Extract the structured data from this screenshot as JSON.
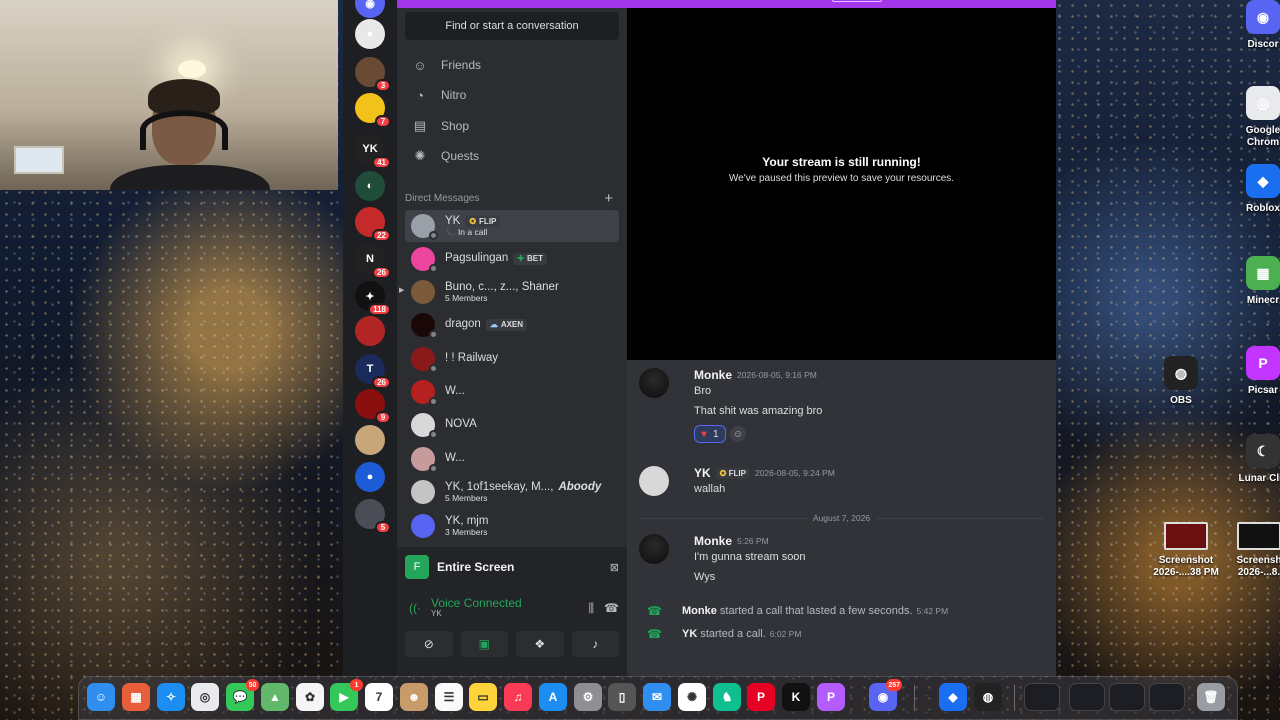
{
  "desktop": {
    "icons": [
      {
        "label": "Discor",
        "name": "desktop-icon-discord",
        "color": "#5865f2",
        "glyph": "◉"
      },
      {
        "label": "Google\nChrom",
        "name": "desktop-icon-chrome",
        "color": "#e8eaed",
        "glyph": "◎"
      },
      {
        "label": "Roblox",
        "name": "desktop-icon-roblox",
        "color": "#1a6ff0",
        "glyph": "◆"
      },
      {
        "label": "Minecr",
        "name": "desktop-icon-minecraft",
        "color": "#4caf50",
        "glyph": "▦"
      },
      {
        "label": "OBS",
        "name": "desktop-icon-obs",
        "color": "#222",
        "glyph": "◍"
      },
      {
        "label": "Picsar",
        "name": "desktop-icon-picsart",
        "color": "#c135ff",
        "glyph": "P"
      },
      {
        "label": "Lunar Clie",
        "name": "desktop-icon-lunar-client",
        "color": "#333",
        "glyph": "☾"
      },
      {
        "label": "Screenshot\n2026-....38 PM",
        "name": "desktop-icon-screenshot-1",
        "color": "#6a1010",
        "glyph": ""
      },
      {
        "label": "Screensh\n2026-...8.",
        "name": "desktop-icon-screenshot-2",
        "color": "#111",
        "glyph": ""
      }
    ]
  },
  "discord": {
    "search_placeholder": "Find or start a conversation",
    "nav": [
      {
        "label": "Friends",
        "icon": "friends-icon",
        "glyph": "☺"
      },
      {
        "label": "Nitro",
        "icon": "nitro-icon",
        "glyph": "◔"
      },
      {
        "label": "Shop",
        "icon": "shop-icon",
        "glyph": "▤"
      },
      {
        "label": "Quests",
        "icon": "quests-icon",
        "glyph": "✺"
      }
    ],
    "dm_header": "Direct Messages",
    "servers": [
      {
        "badge": "",
        "color": "#5865f2",
        "glyph": "◉"
      },
      {
        "badge": "",
        "color": "#e8e8e8",
        "glyph": "●"
      },
      {
        "badge": "3",
        "color": "#6b4a35",
        "glyph": ""
      },
      {
        "badge": "7",
        "color": "#f2c21b",
        "glyph": ""
      },
      {
        "badge": "41",
        "color": "#222",
        "glyph": "YK"
      },
      {
        "badge": "",
        "color": "#1f4d3a",
        "glyph": "◐"
      },
      {
        "badge": "22",
        "color": "#c42a2a",
        "glyph": ""
      },
      {
        "badge": "26",
        "color": "#222",
        "glyph": "N"
      },
      {
        "badge": "118",
        "color": "#111",
        "glyph": "✦"
      },
      {
        "badge": "",
        "color": "#b12525",
        "glyph": ""
      },
      {
        "badge": "26",
        "color": "#1a2a5a",
        "glyph": "T"
      },
      {
        "badge": "9",
        "color": "#8a1010",
        "glyph": ""
      },
      {
        "badge": "",
        "color": "#c9a67a",
        "glyph": ""
      },
      {
        "badge": "",
        "color": "#1e5bd6",
        "glyph": "●"
      },
      {
        "badge": "5",
        "color": "#4a4d55",
        "glyph": ""
      }
    ],
    "dms": [
      {
        "name": "YK",
        "tag": "FLIP",
        "tag_icon": "✪",
        "sub": "📞 In a call",
        "color": "#9aa0a8",
        "active": true,
        "italic_tail": ""
      },
      {
        "name": "Pagsulingan",
        "tag": "BET",
        "tag_icon": "✚",
        "sub": "",
        "color": "#eb459e",
        "active": false,
        "italic_tail": ""
      },
      {
        "name": "Buno, c..., z..., Shaner",
        "tag": "",
        "tag_icon": "",
        "sub": "5 Members",
        "color": "#7a5a3a",
        "active": false,
        "italic_tail": ""
      },
      {
        "name": "dragon",
        "tag": "AXEN",
        "tag_icon": "☁",
        "sub": "",
        "color": "#1a0808",
        "active": false,
        "italic_tail": ""
      },
      {
        "name": "! ! Railway",
        "tag": "",
        "tag_icon": "",
        "sub": "",
        "color": "#8a1a1a",
        "active": false,
        "italic_tail": ""
      },
      {
        "name": "W...",
        "tag": "",
        "tag_icon": "",
        "sub": "",
        "color": "#b52020",
        "active": false,
        "italic_tail": ""
      },
      {
        "name": "NOVA",
        "tag": "",
        "tag_icon": "",
        "sub": "",
        "color": "#d8d8d8",
        "active": false,
        "italic_tail": ""
      },
      {
        "name": "W...",
        "tag": "",
        "tag_icon": "",
        "sub": "",
        "color": "#c79b9b",
        "active": false,
        "italic_tail": ""
      },
      {
        "name": "YK, 1of1seekay, M...,",
        "tag": "",
        "tag_icon": "",
        "sub": "5 Members",
        "color": "#c4c4c4",
        "active": false,
        "italic_tail": "Aboody"
      },
      {
        "name": "YK, mjm",
        "tag": "",
        "tag_icon": "",
        "sub": "3 Members",
        "color": "#5865f2",
        "active": false,
        "italic_tail": ""
      }
    ],
    "stream": {
      "label": "Entire Screen"
    },
    "voice": {
      "status": "Voice Connected",
      "channel": "YK"
    },
    "preview": {
      "title": "Your stream is still running!",
      "subtitle": "We've paused this preview to save your resources."
    },
    "messages": {
      "m1": {
        "author": "Monke",
        "time": "2026-08-05, 9:16 PM",
        "lines": [
          "Bro",
          "That shit was amazing bro"
        ],
        "reaction_count": "1"
      },
      "m2": {
        "author": "YK",
        "tag": "FLIP",
        "time": "2026-08-05, 9:24 PM",
        "lines": [
          "wallah"
        ]
      },
      "divider": "August 7, 2026",
      "m3": {
        "author": "Monke",
        "time": "5:26 PM",
        "lines": [
          "I'm gunna stream soon",
          "Wys"
        ]
      },
      "sys1": {
        "author": "Monke",
        "text": " started a call that lasted a few seconds.",
        "time": "5:42 PM"
      },
      "sys2": {
        "author": "YK",
        "text": " started a call.",
        "time": "6:02 PM"
      }
    }
  },
  "dock": {
    "apps": [
      {
        "name": "finder",
        "color": "#2f8ff0",
        "glyph": "☺",
        "badge": ""
      },
      {
        "name": "launchpad",
        "color": "#e85d3a",
        "glyph": "▦",
        "badge": ""
      },
      {
        "name": "safari",
        "color": "#1c8ef2",
        "glyph": "✧",
        "badge": ""
      },
      {
        "name": "chrome",
        "color": "#e8eaed",
        "glyph": "◎",
        "badge": ""
      },
      {
        "name": "messages",
        "color": "#34c759",
        "glyph": "💬",
        "badge": "50"
      },
      {
        "name": "maps",
        "color": "#61b86a",
        "glyph": "▲",
        "badge": ""
      },
      {
        "name": "photos",
        "color": "#f5f5f5",
        "glyph": "✿",
        "badge": ""
      },
      {
        "name": "facetime",
        "color": "#34c759",
        "glyph": "▶",
        "badge": "1"
      },
      {
        "name": "calendar",
        "color": "#ffffff",
        "glyph": "7",
        "badge": ""
      },
      {
        "name": "contacts",
        "color": "#c89c6a",
        "glyph": "☻",
        "badge": ""
      },
      {
        "name": "reminders",
        "color": "#fafafa",
        "glyph": "☰",
        "badge": ""
      },
      {
        "name": "notes",
        "color": "#ffd43b",
        "glyph": "▭",
        "badge": ""
      },
      {
        "name": "music",
        "color": "#fb3a55",
        "glyph": "♫",
        "badge": ""
      },
      {
        "name": "app-store",
        "color": "#1c8ef2",
        "glyph": "A",
        "badge": ""
      },
      {
        "name": "system-settings",
        "color": "#8e8e93",
        "glyph": "⚙",
        "badge": ""
      },
      {
        "name": "iphone-mirroring",
        "color": "#555",
        "glyph": "▯",
        "badge": ""
      },
      {
        "name": "mail",
        "color": "#2f8ff0",
        "glyph": "✉",
        "badge": ""
      },
      {
        "name": "chatgpt",
        "color": "#ffffff",
        "glyph": "✺",
        "badge": ""
      },
      {
        "name": "robinhood",
        "color": "#0fbf8f",
        "glyph": "♞",
        "badge": ""
      },
      {
        "name": "pinterest",
        "color": "#e60023",
        "glyph": "P",
        "badge": ""
      },
      {
        "name": "kick",
        "color": "#111",
        "glyph": "K",
        "badge": ""
      },
      {
        "name": "picsart",
        "color": "#b45cff",
        "glyph": "P",
        "badge": ""
      },
      {
        "name": "discord",
        "color": "#5865f2",
        "glyph": "◉",
        "badge": "257"
      },
      {
        "name": "roblox",
        "color": "#1a6ff0",
        "glyph": "◆",
        "badge": ""
      },
      {
        "name": "obs",
        "color": "#222",
        "glyph": "◍",
        "badge": ""
      },
      {
        "name": "trash",
        "color": "#9a9ca3",
        "glyph": "🗑",
        "badge": ""
      }
    ]
  }
}
